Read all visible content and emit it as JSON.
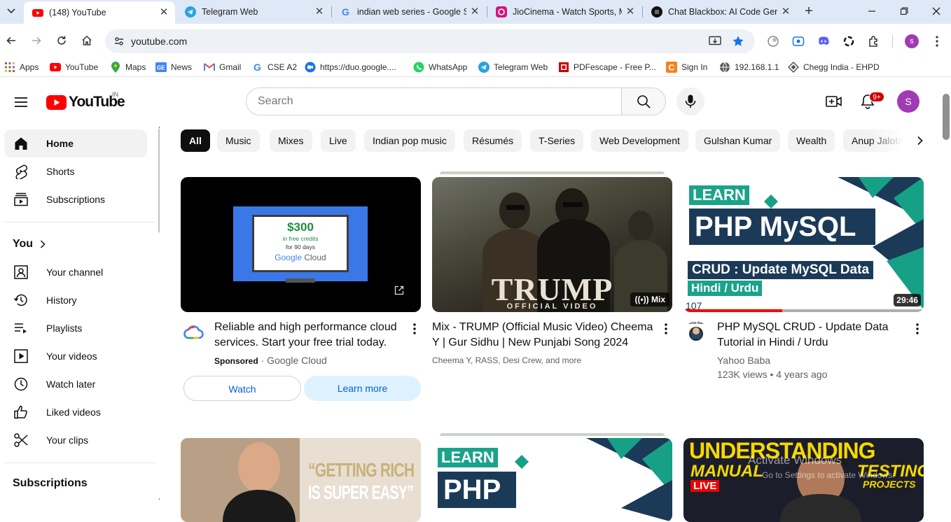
{
  "browser": {
    "tabs": [
      {
        "title": "(148) YouTube",
        "icon": "youtube-icon"
      },
      {
        "title": "Telegram Web",
        "icon": "telegram-icon"
      },
      {
        "title": "indian web series - Google S",
        "icon": "google-icon"
      },
      {
        "title": "JioCinema - Watch Sports, M",
        "icon": "jiocinema-icon"
      },
      {
        "title": "Chat Blackbox: AI Code Gene",
        "icon": "blackbox-icon"
      }
    ],
    "url": "youtube.com",
    "profile_initial": "s",
    "bookmarks": [
      {
        "label": "Apps"
      },
      {
        "label": "YouTube"
      },
      {
        "label": "Maps"
      },
      {
        "label": "News"
      },
      {
        "label": "Gmail"
      },
      {
        "label": "CSE A2"
      },
      {
        "label": "https://duo.google...."
      },
      {
        "label": "WhatsApp"
      },
      {
        "label": "Telegram Web"
      },
      {
        "label": "PDFescape - Free P..."
      },
      {
        "label": "Sign In"
      },
      {
        "label": "192.168.1.1"
      },
      {
        "label": "Chegg India - EHPD"
      }
    ]
  },
  "youtube": {
    "logo_text": "YouTube",
    "country_code": "IN",
    "search_placeholder": "Search",
    "notification_count": "9+",
    "avatar_initial": "S",
    "sidebar": {
      "main": [
        {
          "label": "Home"
        },
        {
          "label": "Shorts"
        },
        {
          "label": "Subscriptions"
        }
      ],
      "you_heading": "You",
      "you_items": [
        {
          "label": "Your channel"
        },
        {
          "label": "History"
        },
        {
          "label": "Playlists"
        },
        {
          "label": "Your videos"
        },
        {
          "label": "Watch later"
        },
        {
          "label": "Liked videos"
        },
        {
          "label": "Your clips"
        }
      ],
      "subscriptions_heading": "Subscriptions"
    },
    "chips": [
      "All",
      "Music",
      "Mixes",
      "Live",
      "Indian pop music",
      "Résumés",
      "T-Series",
      "Web Development",
      "Gulshan Kumar",
      "Wealth",
      "Anup Jalota"
    ],
    "videos": [
      {
        "title": "Reliable and high performance cloud services. Start your free trial today.",
        "sponsored": "Sponsored",
        "channel": "Google Cloud",
        "ad_amount": "$300",
        "ad_line1": "in free credits",
        "ad_line2": "for 90 days",
        "ad_brand1": "Google",
        "ad_brand2": "Cloud",
        "btn_watch": "Watch",
        "btn_learn": "Learn more"
      },
      {
        "title": "Mix - TRUMP (Official Music Video) Cheema Y | Gur Sidhu | New Punjabi Song 2024",
        "channel": "Cheema Y, RASS, Desi Crew, and more",
        "badge": "Mix",
        "thumb_big": "TRUMP",
        "thumb_small": "OFFICIAL VIDEO"
      },
      {
        "title": "PHP MySQL CRUD - Update Data Tutorial in Hindi / Urdu",
        "channel": "Yahoo Baba",
        "stats": "123K views • 4 years ago",
        "duration": "29:46",
        "watched_progress": 0.41,
        "thumb_learn": "LEARN",
        "thumb_main": "PHP MySQL",
        "thumb_sub": "CRUD : Update MySQL Data",
        "thumb_lang": "Hindi / Urdu",
        "thumb_num": "107",
        "channel_logo_text": "Yahoo Baba"
      },
      {
        "thumb_line1": "“GETTING RICH",
        "thumb_line2": "IS SUPER EASY”"
      },
      {
        "thumb_learn": "LEARN",
        "thumb_main": "PHP"
      },
      {
        "thumb_line1": "UNDERSTANDING",
        "thumb_line2": "MANUAL",
        "thumb_line3": "TESTING",
        "thumb_line4": "PROJECTS",
        "thumb_live": "LIVE"
      }
    ],
    "watermark_title": "Activate Windows",
    "watermark_sub": "Go to Settings to activate Windows."
  },
  "colors": {
    "youtube_red": "#ff0000",
    "link_blue": "#065fd4",
    "chrome_tab_bg": "#dfe8f7"
  }
}
